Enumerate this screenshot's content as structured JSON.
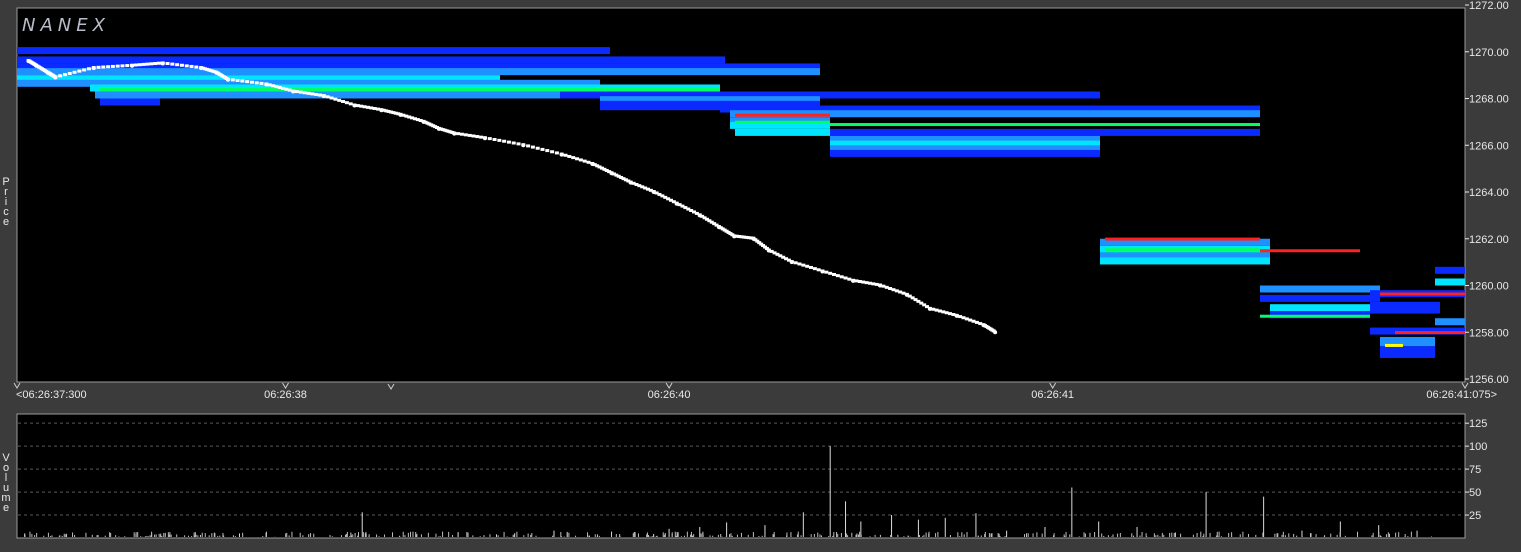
{
  "logo": "NANEX",
  "price_chart": {
    "ylabel": "Price",
    "y_ticks": [
      "1272.00",
      "1270.00",
      "1268.00",
      "1266.00",
      "1264.00",
      "1262.00",
      "1260.00",
      "1258.00",
      "1256.00"
    ],
    "x_ticks": [
      {
        "t": 0.0,
        "label": "<06:26:37:300"
      },
      {
        "t": 0.7,
        "label": "06:26:38"
      },
      {
        "t": 1.7,
        "label": "06:26:40"
      },
      {
        "t": 2.7,
        "label": "06:26:41"
      },
      {
        "t": 3.775,
        "label": "06:26:41:075>"
      }
    ]
  },
  "volume_chart": {
    "ylabel": "Volume",
    "y_ticks": [
      "125",
      "100",
      "75",
      "50",
      "25"
    ]
  },
  "chart_data": [
    {
      "type": "scatter",
      "title": "",
      "xlabel": "",
      "ylabel": "Price",
      "ylim": [
        1256,
        1272
      ],
      "xlim": [
        0,
        3.775
      ],
      "x_unit": "seconds after 06:26:37:300",
      "trade_series": {
        "name": "",
        "color": "#ffffff",
        "points": [
          [
            0.03,
            1269.6
          ],
          [
            0.05,
            1269.4
          ],
          [
            0.08,
            1269.1
          ],
          [
            0.1,
            1268.9
          ],
          [
            0.2,
            1269.3
          ],
          [
            0.3,
            1269.4
          ],
          [
            0.38,
            1269.5
          ],
          [
            0.48,
            1269.3
          ],
          [
            0.52,
            1269.1
          ],
          [
            0.55,
            1268.8
          ],
          [
            0.65,
            1268.6
          ],
          [
            0.72,
            1268.3
          ],
          [
            0.8,
            1268.1
          ],
          [
            0.88,
            1267.7
          ],
          [
            0.95,
            1267.5
          ],
          [
            1.0,
            1267.3
          ],
          [
            1.06,
            1267.0
          ],
          [
            1.1,
            1266.7
          ],
          [
            1.14,
            1266.5
          ],
          [
            1.22,
            1266.3
          ],
          [
            1.32,
            1266.0
          ],
          [
            1.42,
            1265.6
          ],
          [
            1.5,
            1265.2
          ],
          [
            1.55,
            1264.8
          ],
          [
            1.6,
            1264.4
          ],
          [
            1.66,
            1264.0
          ],
          [
            1.72,
            1263.5
          ],
          [
            1.78,
            1263.0
          ],
          [
            1.83,
            1262.5
          ],
          [
            1.87,
            1262.1
          ],
          [
            1.92,
            1262.0
          ],
          [
            1.96,
            1261.5
          ],
          [
            2.02,
            1261.0
          ],
          [
            2.1,
            1260.6
          ],
          [
            2.18,
            1260.2
          ],
          [
            2.25,
            1260.0
          ],
          [
            2.32,
            1259.6
          ],
          [
            2.38,
            1259.0
          ],
          [
            2.45,
            1258.7
          ],
          [
            2.52,
            1258.3
          ],
          [
            2.55,
            1258.0
          ]
        ]
      },
      "depth_legend_colors": {
        "low": "#0a2aff",
        "mid": "#1e90ff",
        "high": "#00e5ff",
        "trade_level": "#00ff66",
        "offer": "#ff2020",
        "marker": "#ffff00"
      }
    },
    {
      "type": "bar",
      "title": "",
      "xlabel": "",
      "ylabel": "Volume",
      "ylim": [
        0,
        135
      ],
      "spikes": [
        [
          0.02,
          5
        ],
        [
          0.35,
          3
        ],
        [
          0.58,
          5
        ],
        [
          0.9,
          28
        ],
        [
          1.15,
          6
        ],
        [
          1.25,
          4
        ],
        [
          1.4,
          8
        ],
        [
          1.55,
          7
        ],
        [
          1.7,
          10
        ],
        [
          1.78,
          12
        ],
        [
          1.85,
          17
        ],
        [
          1.95,
          14
        ],
        [
          2.05,
          28
        ],
        [
          2.12,
          100
        ],
        [
          2.16,
          40
        ],
        [
          2.2,
          18
        ],
        [
          2.28,
          25
        ],
        [
          2.35,
          20
        ],
        [
          2.42,
          22
        ],
        [
          2.5,
          27
        ],
        [
          2.58,
          8
        ],
        [
          2.68,
          12
        ],
        [
          2.75,
          55
        ],
        [
          2.82,
          18
        ],
        [
          2.92,
          12
        ],
        [
          3.02,
          6
        ],
        [
          3.1,
          50
        ],
        [
          3.25,
          45
        ],
        [
          3.35,
          8
        ],
        [
          3.45,
          18
        ],
        [
          3.55,
          14
        ],
        [
          3.65,
          8
        ]
      ],
      "y_ticks": [
        125,
        100,
        75,
        50,
        25
      ]
    }
  ]
}
